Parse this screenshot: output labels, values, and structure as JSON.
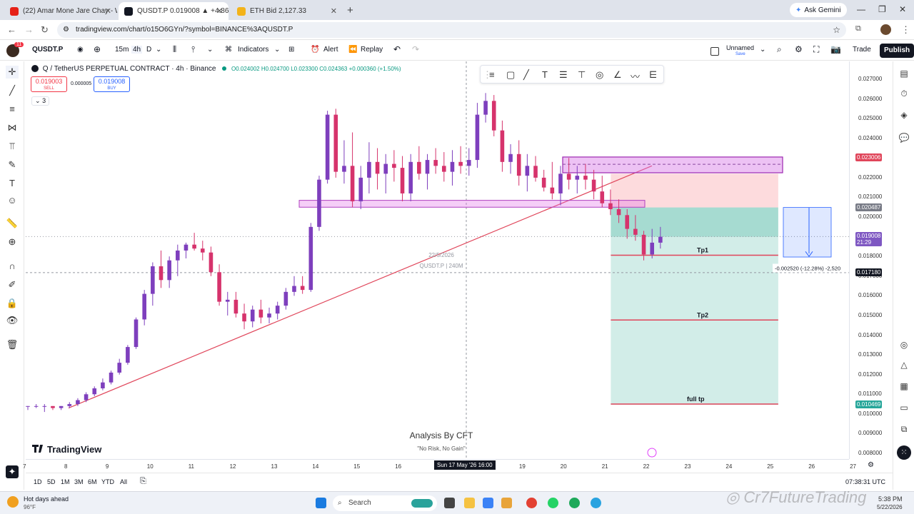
{
  "browser": {
    "tabs": [
      {
        "title": "(22) Amar Mone Jare Chay - Wi",
        "color": "#e62117"
      },
      {
        "title": "QUSDT.P 0.019008 ▲ +4.86% U",
        "color": "#131722"
      },
      {
        "title": "ETH Bid 2,127.33",
        "color": "#f3b31a"
      }
    ],
    "ask_gemini": "Ask Gemini",
    "url": "tradingview.com/chart/o15O6GYn/?symbol=BINANCE%3AQUSDT.P"
  },
  "toolbar": {
    "badge": "11",
    "symbol": "QUSDT.P",
    "intervals": [
      "15m",
      "4h",
      "D"
    ],
    "indicators": "Indicators",
    "alert": "Alert",
    "replay": "Replay",
    "layout_name": "Unnamed",
    "layout_sub": "Save",
    "trade": "Trade",
    "publish": "Publish"
  },
  "legend": {
    "title": "Q / TetherUS PERPETUAL CONTRACT · 4h · Binance",
    "ohlc": "O0.024002  H0.024700  L0.023300  C0.024363  +0.000360 (+1.50%)",
    "sell_price": "0.019003",
    "sell_label": "SELL",
    "spread": "0.000005",
    "buy_price": "0.019008",
    "buy_label": "BUY",
    "collapse": "3"
  },
  "chart": {
    "watermark_date": "22/5/2026",
    "watermark_sym": "QUSDT.P  |  240M",
    "tp1": "Tp1",
    "tp2": "Tp2",
    "full_tp": "full tp",
    "measure": "-0.002520 (-12.28%) -2,520",
    "analysis": "Analysis By CFT",
    "motto": "\"No Risk, No Gain\"",
    "logo": "TradingView",
    "footer_watermark": "Cr7FutureTrading"
  },
  "chart_data": {
    "type": "candlestick",
    "price_scale": [
      0.008,
      0.027
    ],
    "price_ticks": [
      "0.027000",
      "0.026000",
      "0.025000",
      "0.024000",
      "0.023000",
      "0.022000",
      "0.021000",
      "0.020000",
      "0.019000",
      "0.018000",
      "0.017000",
      "0.016000",
      "0.015000",
      "0.014000",
      "0.013000",
      "0.012000",
      "0.011000",
      "0.010000",
      "0.009000",
      "0.008000"
    ],
    "price_tags": [
      {
        "label": "0.023006",
        "value": 0.023006,
        "color": "#e0455a"
      },
      {
        "label": "0.020487",
        "value": 0.020487,
        "color": "#787b86"
      },
      {
        "label": "0.019008",
        "value": 0.019008,
        "color": "#7e57c2",
        "sub": "21:29"
      },
      {
        "label": "0.017180",
        "value": 0.01718,
        "color": "#131722"
      },
      {
        "label": "0.010469",
        "value": 0.010469,
        "color": "#26a69a"
      }
    ],
    "time_ticks": [
      "7",
      "8",
      "9",
      "10",
      "11",
      "12",
      "13",
      "14",
      "15",
      "16",
      "17",
      "18",
      "19",
      "20",
      "21",
      "22",
      "23",
      "24",
      "25",
      "26",
      "27"
    ],
    "crosshair_time": "Sun 17 May '26   16:00",
    "candles": [
      [
        0.0104,
        0.0104,
        0.0102,
        0.0104
      ],
      [
        0.0104,
        0.0105,
        0.0103,
        0.0104
      ],
      [
        0.0104,
        0.0105,
        0.0101,
        0.0104
      ],
      [
        0.0104,
        0.0104,
        0.0102,
        0.0103
      ],
      [
        0.0103,
        0.0104,
        0.0102,
        0.0104
      ],
      [
        0.0104,
        0.0106,
        0.0103,
        0.0105
      ],
      [
        0.0105,
        0.0108,
        0.0104,
        0.0107
      ],
      [
        0.0107,
        0.0111,
        0.0106,
        0.011
      ],
      [
        0.011,
        0.0114,
        0.0109,
        0.0113
      ],
      [
        0.0113,
        0.0118,
        0.0112,
        0.0116
      ],
      [
        0.0116,
        0.0122,
        0.0115,
        0.0121
      ],
      [
        0.0121,
        0.0128,
        0.012,
        0.0126
      ],
      [
        0.0126,
        0.0135,
        0.0125,
        0.0134
      ],
      [
        0.0134,
        0.0149,
        0.0133,
        0.0148
      ],
      [
        0.0148,
        0.0163,
        0.0145,
        0.0161
      ],
      [
        0.0161,
        0.0177,
        0.0155,
        0.0175
      ],
      [
        0.0175,
        0.0183,
        0.0164,
        0.0168
      ],
      [
        0.0168,
        0.018,
        0.0164,
        0.0178
      ],
      [
        0.0178,
        0.0186,
        0.017,
        0.0183
      ],
      [
        0.0183,
        0.0187,
        0.0179,
        0.0186
      ],
      [
        0.0186,
        0.0192,
        0.0183,
        0.0184
      ],
      [
        0.0184,
        0.0188,
        0.0178,
        0.0182
      ],
      [
        0.0182,
        0.0185,
        0.017,
        0.0172
      ],
      [
        0.0172,
        0.0176,
        0.0155,
        0.0157
      ],
      [
        0.0157,
        0.0162,
        0.015,
        0.0158
      ],
      [
        0.0158,
        0.0162,
        0.0149,
        0.0151
      ],
      [
        0.0151,
        0.0156,
        0.0143,
        0.0147
      ],
      [
        0.0147,
        0.0155,
        0.0144,
        0.0153
      ],
      [
        0.0153,
        0.0158,
        0.0146,
        0.0149
      ],
      [
        0.0149,
        0.0154,
        0.0146,
        0.0151
      ],
      [
        0.0151,
        0.0157,
        0.0148,
        0.0155
      ],
      [
        0.0155,
        0.0164,
        0.0153,
        0.0162
      ],
      [
        0.0162,
        0.017,
        0.016,
        0.0165
      ],
      [
        0.0165,
        0.017,
        0.0161,
        0.0163
      ],
      [
        0.0163,
        0.0197,
        0.0162,
        0.0195
      ],
      [
        0.0195,
        0.0221,
        0.0193,
        0.0219
      ],
      [
        0.0219,
        0.0254,
        0.0217,
        0.0252
      ],
      [
        0.0252,
        0.0255,
        0.022,
        0.0223
      ],
      [
        0.0223,
        0.0239,
        0.0217,
        0.0226
      ],
      [
        0.0226,
        0.0243,
        0.0205,
        0.0208
      ],
      [
        0.0208,
        0.0226,
        0.0204,
        0.022
      ],
      [
        0.022,
        0.0238,
        0.0212,
        0.0228
      ],
      [
        0.0228,
        0.0235,
        0.0214,
        0.0222
      ],
      [
        0.0222,
        0.0232,
        0.0212,
        0.0227
      ],
      [
        0.0227,
        0.0234,
        0.0218,
        0.0225
      ],
      [
        0.0225,
        0.0231,
        0.0208,
        0.0212
      ],
      [
        0.0212,
        0.0232,
        0.0208,
        0.0228
      ],
      [
        0.0228,
        0.0236,
        0.0219,
        0.0222
      ],
      [
        0.0222,
        0.0232,
        0.0214,
        0.0229
      ],
      [
        0.0229,
        0.0235,
        0.0222,
        0.0226
      ],
      [
        0.0226,
        0.0233,
        0.0218,
        0.0223
      ],
      [
        0.0223,
        0.0234,
        0.0216,
        0.0228
      ],
      [
        0.0228,
        0.0236,
        0.0222,
        0.0226
      ],
      [
        0.0226,
        0.0235,
        0.0221,
        0.0229
      ],
      [
        0.0229,
        0.0258,
        0.0225,
        0.0252
      ],
      [
        0.0252,
        0.0263,
        0.0248,
        0.0259
      ],
      [
        0.0259,
        0.0262,
        0.0241,
        0.0244
      ],
      [
        0.0244,
        0.0249,
        0.0223,
        0.0228
      ],
      [
        0.0228,
        0.0237,
        0.0222,
        0.0232
      ],
      [
        0.0232,
        0.0239,
        0.0216,
        0.0221
      ],
      [
        0.0221,
        0.0232,
        0.0213,
        0.0226
      ],
      [
        0.0226,
        0.0231,
        0.0218,
        0.022
      ],
      [
        0.022,
        0.0224,
        0.0213,
        0.0215
      ],
      [
        0.0215,
        0.0228,
        0.0209,
        0.0212
      ],
      [
        0.0212,
        0.0226,
        0.0206,
        0.0222
      ],
      [
        0.0222,
        0.023,
        0.0214,
        0.0219
      ],
      [
        0.0219,
        0.0226,
        0.0212,
        0.0221
      ],
      [
        0.0221,
        0.0227,
        0.0214,
        0.0219
      ],
      [
        0.0219,
        0.0224,
        0.0209,
        0.0213
      ],
      [
        0.0213,
        0.0221,
        0.0205,
        0.0207
      ],
      [
        0.0207,
        0.0214,
        0.0201,
        0.0204
      ],
      [
        0.0204,
        0.0209,
        0.0197,
        0.0201
      ],
      [
        0.0201,
        0.0204,
        0.0189,
        0.0194
      ],
      [
        0.0194,
        0.0201,
        0.0188,
        0.0191
      ],
      [
        0.0191,
        0.0193,
        0.0178,
        0.0181
      ],
      [
        0.0181,
        0.0194,
        0.0179,
        0.0187
      ],
      [
        0.0187,
        0.0195,
        0.0184,
        0.019
      ]
    ]
  },
  "bottom": {
    "ranges": [
      "1D",
      "5D",
      "1M",
      "3M",
      "6M",
      "YTD",
      "All"
    ],
    "clock": "07:38:31 UTC"
  },
  "taskbar": {
    "weather_title": "Hot days ahead",
    "weather_temp": "96°F",
    "search": "Search",
    "time": "5:38 PM",
    "date": "5/22/2026"
  }
}
